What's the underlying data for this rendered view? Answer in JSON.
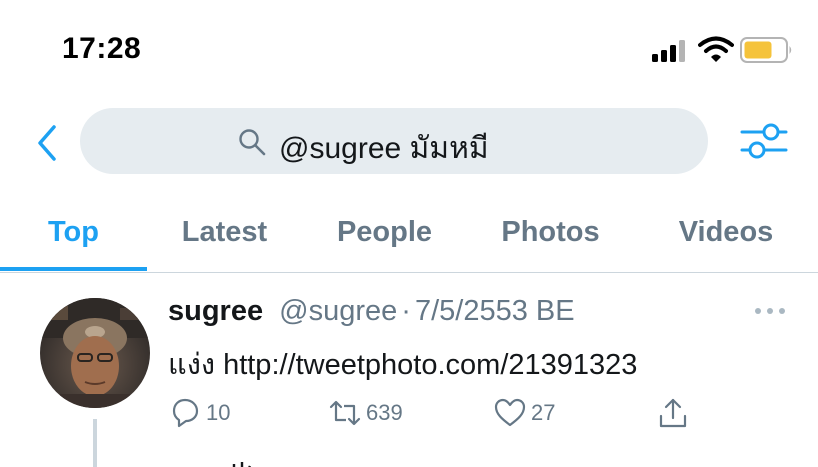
{
  "status_bar": {
    "time": "17:28",
    "icons": [
      "signal-icon",
      "wifi-icon",
      "battery-icon"
    ],
    "battery_color": "#f5c33b"
  },
  "search": {
    "query": "@sugree มัมหมี",
    "icons": [
      "back-icon",
      "search-icon",
      "filter-icon"
    ]
  },
  "tabs": [
    {
      "label": "Top",
      "active": true
    },
    {
      "label": "Latest",
      "active": false
    },
    {
      "label": "People",
      "active": false
    },
    {
      "label": "Photos",
      "active": false
    },
    {
      "label": "Videos",
      "active": false
    }
  ],
  "tweet": {
    "author_name": "sugree",
    "author_handle": "@sugree",
    "separator": "·",
    "date": "7/5/2553 BE",
    "text": "แง่ง http://tweetphoto.com/21391323",
    "actions": {
      "reply_count": "10",
      "retweet_count": "639",
      "like_count": "27"
    },
    "icons": [
      "more-icon",
      "reply-icon",
      "retweet-icon",
      "like-icon",
      "share-icon"
    ]
  },
  "colors": {
    "accent": "#1da1f2",
    "secondary_text": "#657786",
    "search_bg": "#e6ecf0",
    "divider": "#ccd6dd"
  }
}
